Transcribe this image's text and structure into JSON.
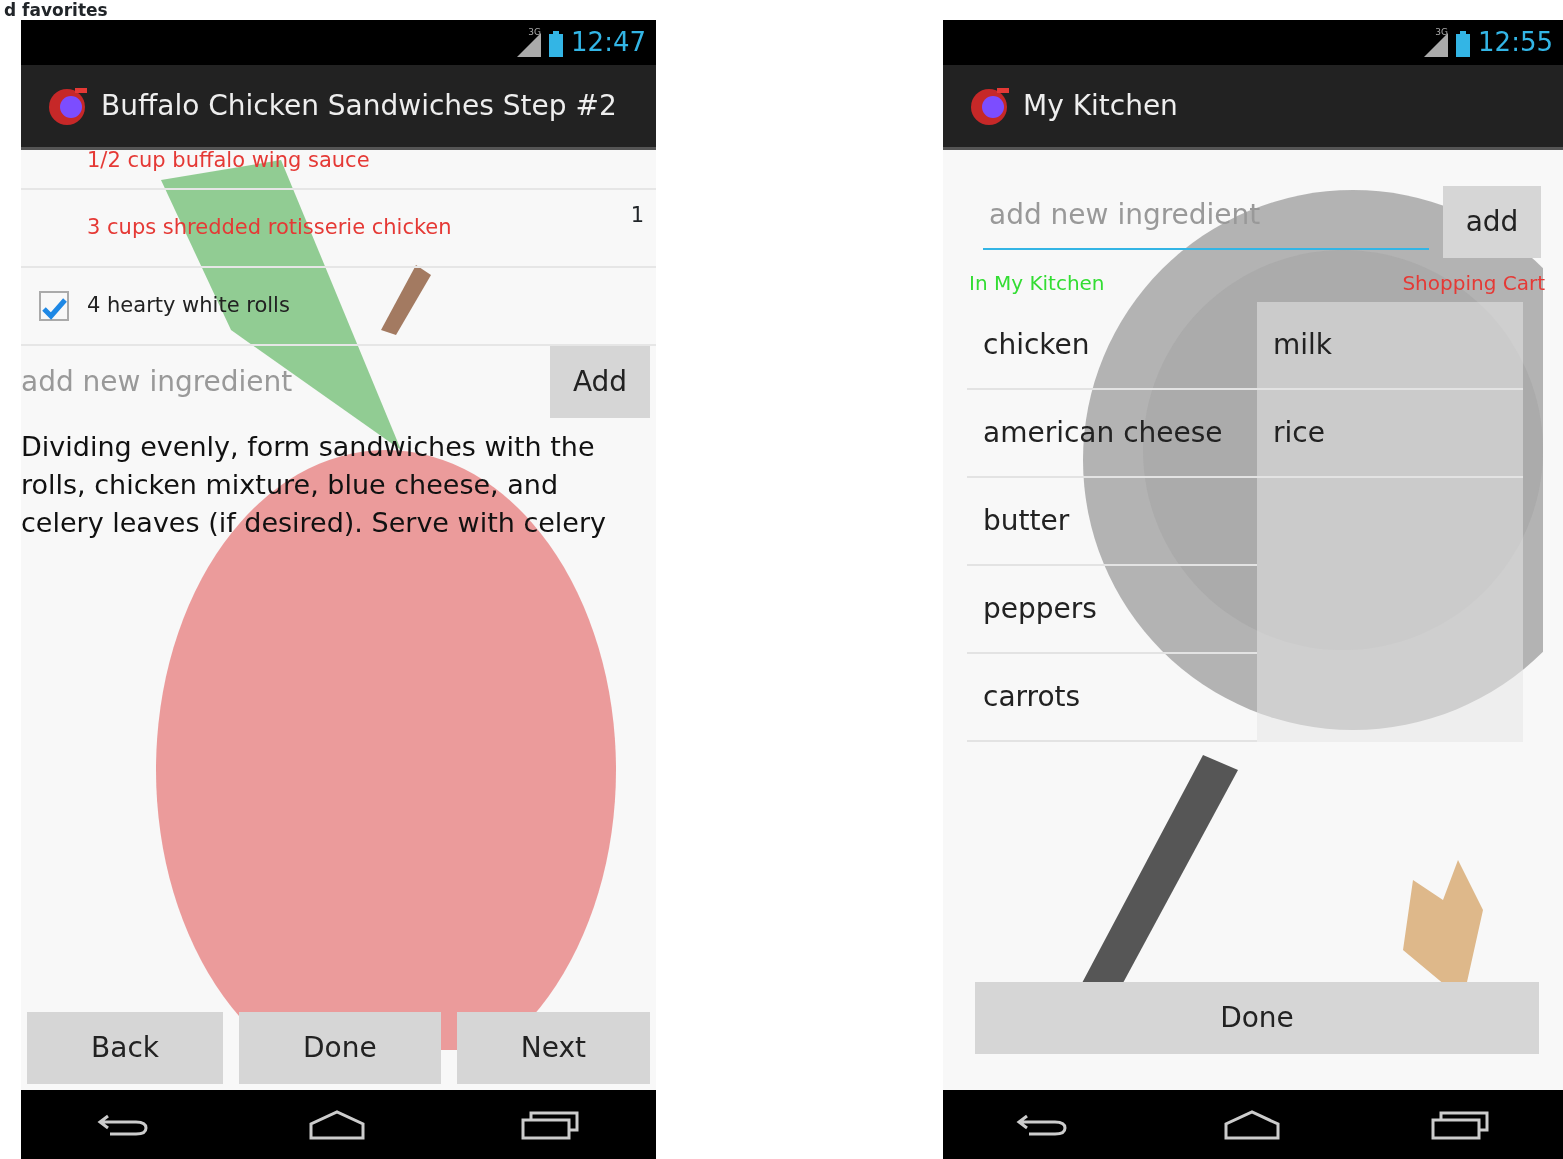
{
  "heading": "d favorites",
  "screens": [
    {
      "status_bar": {
        "network": "3G",
        "time": "12:47"
      },
      "title": "Buffalo Chicken Sandwiches Step #2",
      "ingredients": [
        {
          "text": "1/2 cup buffalo wing sauce",
          "checked": false
        },
        {
          "text": "3 cups shredded rotisserie chicken",
          "checked": false,
          "count": "1"
        },
        {
          "text": "4 hearty white rolls",
          "checked": true
        }
      ],
      "new_ingredient": {
        "placeholder": "add new ingredient",
        "button": "Add"
      },
      "instructions": "Dividing evenly, form sandwiches with the rolls, chicken mixture, blue cheese, and celery leaves (if desired). Serve with celery",
      "buttons": [
        "Back",
        "Done",
        "Next"
      ]
    },
    {
      "status_bar": {
        "network": "3G",
        "time": "12:55"
      },
      "title": "My Kitchen",
      "new_ingredient": {
        "placeholder": "add new ingredient",
        "button": "add"
      },
      "lists": [
        {
          "title": "In My Kitchen",
          "color": "#33dd33",
          "items": [
            "chicken",
            "american cheese",
            "butter",
            "peppers",
            "carrots"
          ]
        },
        {
          "title": "Shopping Cart",
          "color": "#e53935",
          "items": [
            "milk",
            "rice"
          ]
        }
      ],
      "buttons": [
        "Done"
      ]
    }
  ]
}
